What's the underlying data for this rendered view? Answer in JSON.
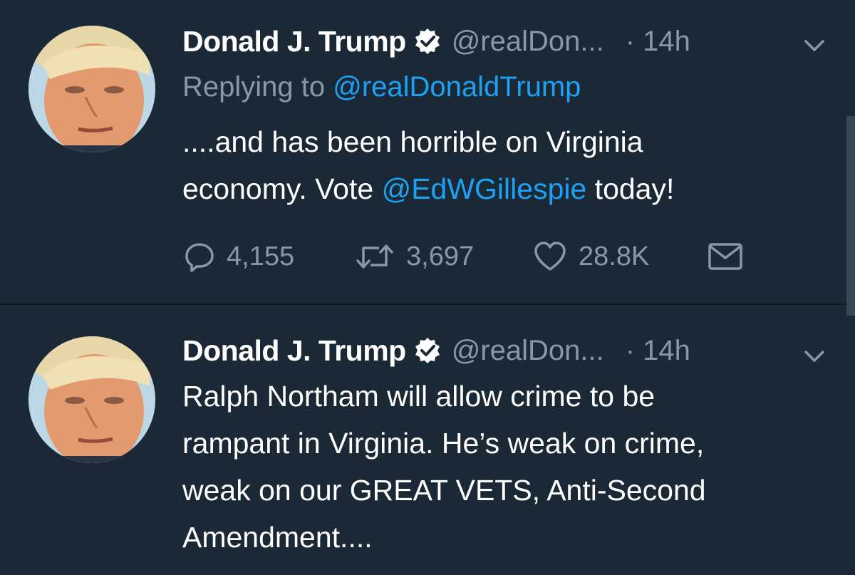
{
  "tweets": [
    {
      "author_name": "Donald J. Trump",
      "handle": "@realDon...",
      "time": "· 14h",
      "reply_prefix": "Replying to ",
      "reply_to": "@realDonaldTrump",
      "text_line1": "....and has been horrible on Virginia",
      "text_line2_pre": "economy. Vote ",
      "text_line2_mention": "@EdWGillespie",
      "text_line2_post": " today!",
      "replies": "4,155",
      "retweets": "3,697",
      "likes": "28.8K"
    },
    {
      "author_name": "Donald J. Trump",
      "handle": "@realDon...",
      "time": "· 14h",
      "text_lines": [
        "Ralph Northam will allow crime to be",
        "rampant in Virginia. He’s weak on crime,",
        "weak on our GREAT VETS, Anti-Second",
        "Amendment...."
      ]
    }
  ],
  "icons": {
    "verified": "verified-badge-icon",
    "caret": "chevron-down-icon",
    "reply": "reply-icon",
    "retweet": "retweet-icon",
    "like": "heart-icon",
    "dm": "envelope-icon"
  },
  "colors": {
    "background": "#1b2836",
    "link": "#1da1f2",
    "muted": "#8899a6"
  }
}
